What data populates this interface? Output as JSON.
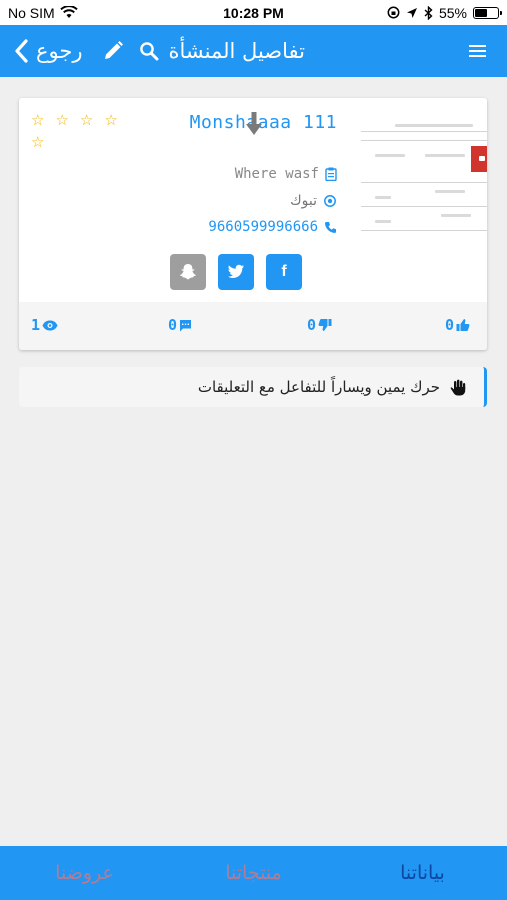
{
  "status_bar": {
    "carrier": "No SIM",
    "time": "10:28 PM",
    "battery_percent": "55%",
    "battery_level": 0.55
  },
  "header": {
    "back_label": "رجوع",
    "title": "تفاصيل المنشأة"
  },
  "business": {
    "name": "Monshaaaa 111",
    "description": "Where wasf",
    "city": "تبوك",
    "phone": "9660599996666",
    "rating_max": 5,
    "rating_value": 0,
    "social": [
      "snapchat-icon",
      "twitter-icon",
      "facebook-icon"
    ],
    "facebook_label": "f"
  },
  "stats": {
    "views": "1",
    "comments": "0",
    "dislikes": "0",
    "likes": "0"
  },
  "hint": {
    "text": "حرك يمين ويساراً للتفاعل مع التعليقات"
  },
  "bottom_nav": {
    "items": [
      {
        "label": "عروضنا"
      },
      {
        "label": "منتجاتنا"
      },
      {
        "label": "بياناتنا"
      }
    ],
    "active_index": 2
  },
  "colors": {
    "primary": "#2196f3",
    "star": "#f4b400",
    "snapchat_bg": "#9e9e9e",
    "nav_inactive": "#e57373",
    "nav_active": "#0d47a1"
  }
}
